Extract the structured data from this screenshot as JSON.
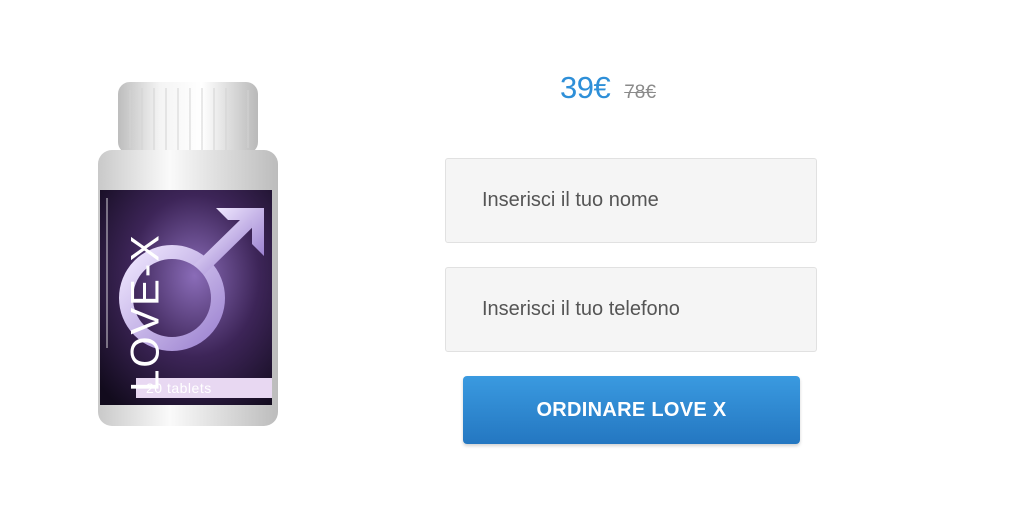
{
  "product": {
    "brand": "LOVE-X",
    "count_label": "20 tablets"
  },
  "pricing": {
    "new_price": "39€",
    "old_price": "78€"
  },
  "form": {
    "name_placeholder": "Inserisci il tuo nome",
    "phone_placeholder": "Inserisci il tuo telefono",
    "submit_label": "ORDINARE LOVE X"
  },
  "colors": {
    "accent": "#2e8fd8",
    "button": "#2a83cf",
    "label_purple": "#4a2a6e"
  }
}
